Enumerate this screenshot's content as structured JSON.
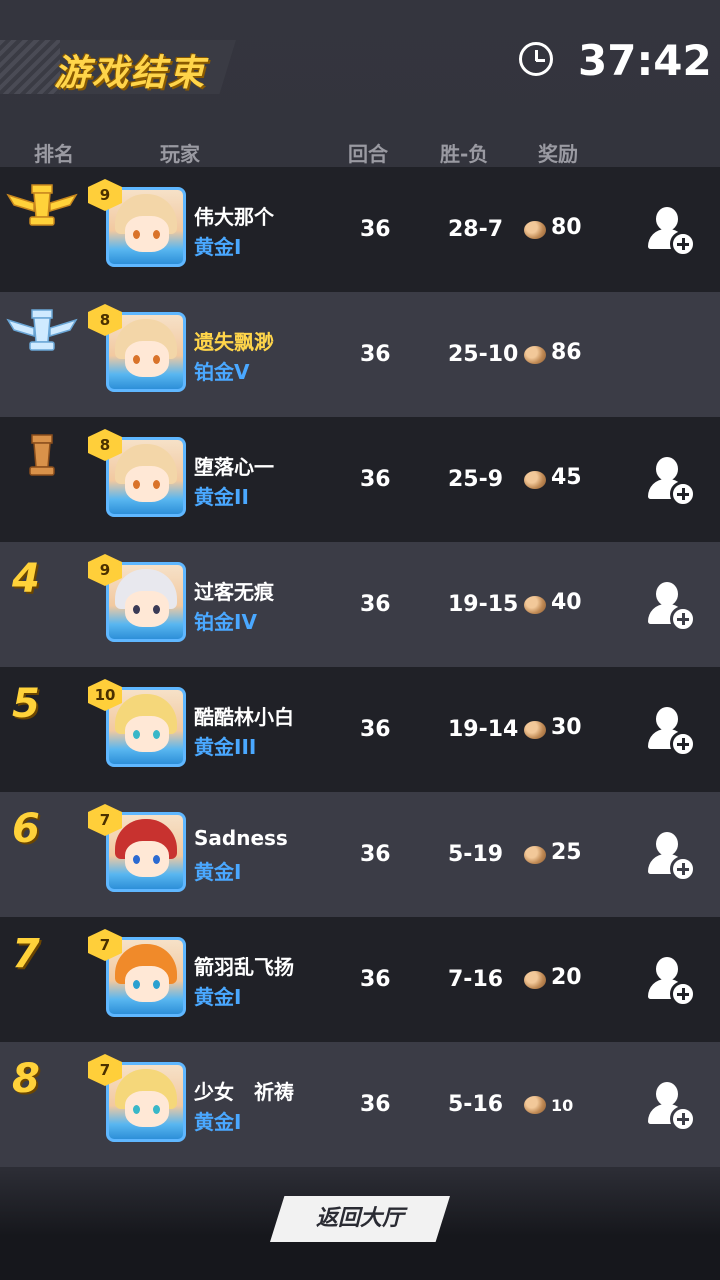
{
  "header": {
    "title": "游戏结束",
    "timer": "37:42"
  },
  "columns": {
    "rank": "排名",
    "player": "玩家",
    "rounds": "回合",
    "record": "胜-负",
    "reward": "奖励"
  },
  "players": [
    {
      "rank": "1",
      "medal": "gold-rook-medal",
      "level": "9",
      "name": "伟大那个",
      "tier": "黄金I",
      "rounds": "36",
      "record": "28-7",
      "reward": "80",
      "add_friend": true,
      "highlight": false
    },
    {
      "rank": "2",
      "medal": "silver-rook-medal",
      "level": "8",
      "name": "遗失飘渺",
      "tier": "铂金V",
      "rounds": "36",
      "record": "25-10",
      "reward": "86",
      "add_friend": false,
      "highlight": true
    },
    {
      "rank": "3",
      "medal": "bronze-rook-medal",
      "level": "8",
      "name": "堕落心一",
      "tier": "黄金II",
      "rounds": "36",
      "record": "25-9",
      "reward": "45",
      "add_friend": true,
      "highlight": false
    },
    {
      "rank": "4",
      "medal": "",
      "level": "9",
      "name": "过客无痕",
      "tier": "铂金IV",
      "rounds": "36",
      "record": "19-15",
      "reward": "40",
      "add_friend": true,
      "highlight": false
    },
    {
      "rank": "5",
      "medal": "",
      "level": "10",
      "name": "酷酷林小白",
      "tier": "黄金III",
      "rounds": "36",
      "record": "19-14",
      "reward": "30",
      "add_friend": true,
      "highlight": false
    },
    {
      "rank": "6",
      "medal": "",
      "level": "7",
      "name": "Sadness",
      "tier": "黄金I",
      "rounds": "36",
      "record": "5-19",
      "reward": "25",
      "add_friend": true,
      "highlight": false
    },
    {
      "rank": "7",
      "medal": "",
      "level": "7",
      "name": "箭羽乱飞扬",
      "tier": "黄金I",
      "rounds": "36",
      "record": "7-16",
      "reward": "20",
      "add_friend": true,
      "highlight": false
    },
    {
      "rank": "8",
      "medal": "",
      "level": "7",
      "name": "少女　祈祷",
      "tier": "黄金I",
      "rounds": "36",
      "record": "5-16",
      "reward": "10",
      "add_friend": true,
      "highlight": false
    }
  ],
  "footer": {
    "back_label": "返回大厅"
  },
  "colors": {
    "accent_gold": "#ffd54a",
    "tier_blue": "#4aa8ff",
    "row_dark": "#202127",
    "row_light": "#3b3c46"
  }
}
